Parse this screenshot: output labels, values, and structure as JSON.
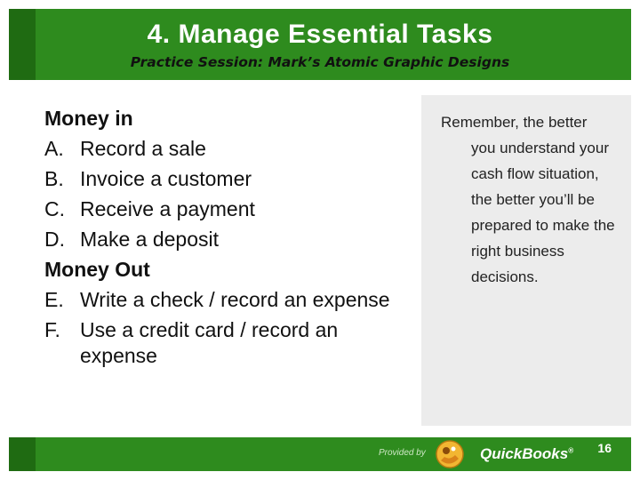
{
  "slide": {
    "title": "4. Manage Essential Tasks",
    "subtitle": "Practice Session: Mark’s Atomic Graphic Designs"
  },
  "list": {
    "money_in": "Money in",
    "money_in_items": [
      {
        "letter": "A.",
        "text": "Record a sale"
      },
      {
        "letter": "B.",
        "text": "Invoice a customer"
      },
      {
        "letter": "C.",
        "text": "Receive a payment"
      },
      {
        "letter": "D.",
        "text": "Make a deposit"
      }
    ],
    "money_out": "Money Out",
    "money_out_items": [
      {
        "letter": "E.",
        "text": "Write a check / record an expense"
      },
      {
        "letter": "F.",
        "text": "Use a credit card / record an expense"
      }
    ]
  },
  "callout": {
    "first_line": "Remember, the better",
    "rest": "you understand your cash flow situation, the better you’ll be prepared to make the right business decisions."
  },
  "footer": {
    "provided_by": "Provided by",
    "brand": "QuickBooks",
    "registered": "®",
    "page_number": "16",
    "logo_icon": "quickbooks-mascot-icon"
  },
  "colors": {
    "header_green": "#2e8b1e",
    "stripe_green": "#1f6b12",
    "callout_bg": "#ececec"
  }
}
